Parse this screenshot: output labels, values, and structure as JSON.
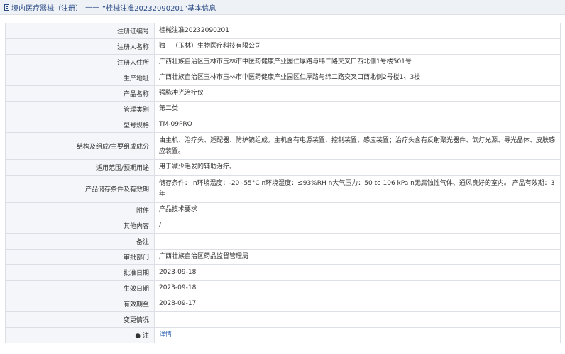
{
  "breadcrumb": {
    "part1": "境内医疗器械（注册）",
    "separator": "——",
    "part2": "“桂械注准20232090201”基本信息"
  },
  "rows": [
    {
      "label": "注册证编号",
      "value": "桂械注准20232090201"
    },
    {
      "label": "注册人名称",
      "value": "独一（玉林）生物医疗科技有限公司"
    },
    {
      "label": "注册人住所",
      "value": "广西壮族自治区玉林市玉林市中医药健康产业园仁厚路与纬二路交叉口西北侧1号楼501号"
    },
    {
      "label": "生产地址",
      "value": "广西壮族自治区玉林市玉林市中医药健康产业园区仁厚路与纬二路交叉口西北侧2号楼1、3楼"
    },
    {
      "label": "产品名称",
      "value": "强脉冲光治疗仪"
    },
    {
      "label": "管理类别",
      "value": "第二类"
    },
    {
      "label": "型号规格",
      "value": "TM-09PRO"
    },
    {
      "label": "结构及组成/主要组成成分",
      "value": "由主机、治疗头、适配器、防护镜组成。主机含有电源装置、控制装置、感应装置；治疗头含有反射聚光器件、氙灯光源、导光晶体、皮肤感应装置。"
    },
    {
      "label": "适用范围/预期用途",
      "value": "用于减少毛发的辅助治疗。"
    },
    {
      "label": "产品储存条件及有效期",
      "value": "储存条件： n环境温度：-20 -55°C n环境湿度：≤93%RH n大气压力：50 to 106 kPa n无腐蚀性气体、通风良好的室内。 产品有效期：3年"
    },
    {
      "label": "附件",
      "value": "产品技术要求"
    },
    {
      "label": "其他内容",
      "value": "/"
    },
    {
      "label": "备注",
      "value": ""
    },
    {
      "label": "审批部门",
      "value": "广西壮族自治区药品监督管理局"
    },
    {
      "label": "批准日期",
      "value": "2023-09-18"
    },
    {
      "label": "生效日期",
      "value": "2023-09-18"
    },
    {
      "label": "有效期至",
      "value": "2028-09-17"
    },
    {
      "label": "变更情况",
      "value": ""
    },
    {
      "label": "● 注",
      "value": "详情"
    }
  ]
}
